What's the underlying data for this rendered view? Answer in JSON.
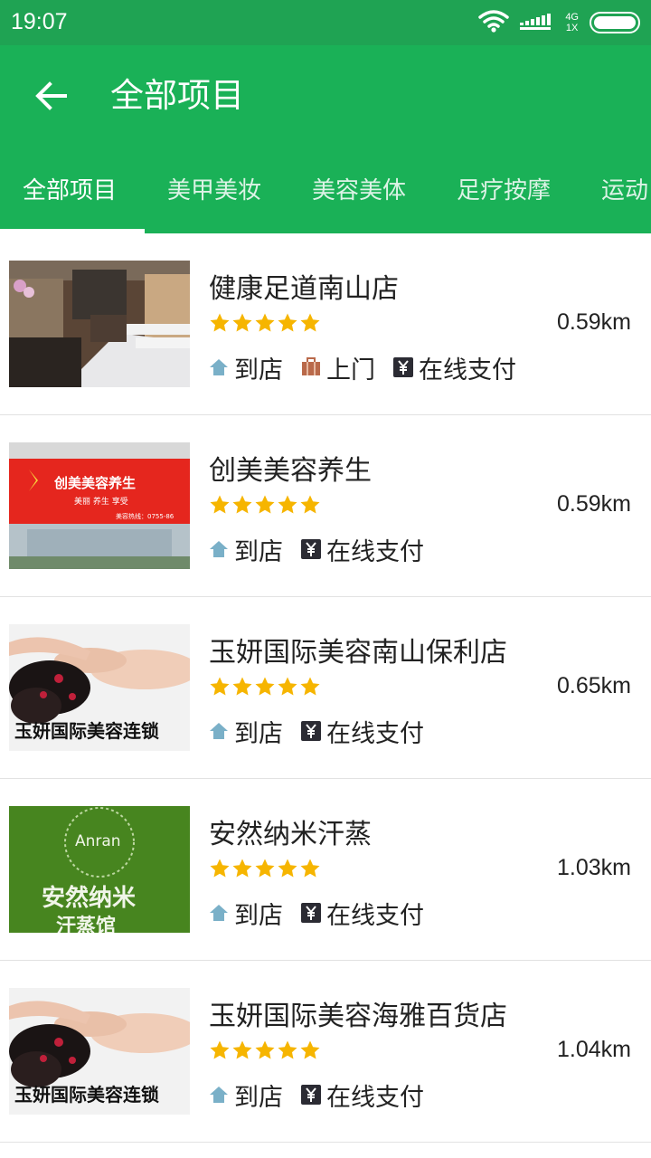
{
  "status_bar": {
    "time": "19:07",
    "network_top": "4G",
    "network_bottom": "1X",
    "icons": [
      "wifi-icon",
      "signal-icon",
      "battery-icon"
    ]
  },
  "app_bar": {
    "back_icon": "back-arrow-icon",
    "title": "全部项目"
  },
  "tabs": [
    {
      "label": "全部项目",
      "active": true
    },
    {
      "label": "美甲美妆",
      "active": false
    },
    {
      "label": "美容美体",
      "active": false
    },
    {
      "label": "足疗按摩",
      "active": false
    },
    {
      "label": "运动",
      "active": false
    }
  ],
  "colors": {
    "status_bar": "#1fa353",
    "app_bar": "#1ab157",
    "star": "#f6b500",
    "home_icon": "#7ab0c8",
    "door_icon": "#b9694a",
    "pay_icon": "#2b2b33"
  },
  "shops": [
    {
      "name": "健康足道南山店",
      "rating": 5,
      "distance": "0.59km",
      "tags": [
        "到店",
        "上门",
        "在线支付"
      ],
      "image": "salon-interior"
    },
    {
      "name": "创美美容养生",
      "rating": 5,
      "distance": "0.59km",
      "tags": [
        "到店",
        "在线支付"
      ],
      "image": "red-storefront-sign",
      "image_text": {
        "main": "创美美容养生",
        "sub": "美丽  养生  享受",
        "phone": "美容热线：0755-86"
      }
    },
    {
      "name": "玉妍国际美容南山保利店",
      "rating": 5,
      "distance": "0.65km",
      "tags": [
        "到店",
        "在线支付"
      ],
      "image": "massage-woman",
      "image_text": {
        "main": "玉妍国际美容连锁"
      }
    },
    {
      "name": "安然纳米汗蒸",
      "rating": 5,
      "distance": "1.03km",
      "tags": [
        "到店",
        "在线支付"
      ],
      "image": "green-sign",
      "image_text": {
        "brand": "Anran",
        "main": "安然纳米",
        "sub": "汗蒸馆"
      }
    },
    {
      "name": "玉妍国际美容海雅百货店",
      "rating": 5,
      "distance": "1.04km",
      "tags": [
        "到店",
        "在线支付"
      ],
      "image": "massage-woman",
      "image_text": {
        "main": "玉妍国际美容连锁"
      }
    }
  ]
}
